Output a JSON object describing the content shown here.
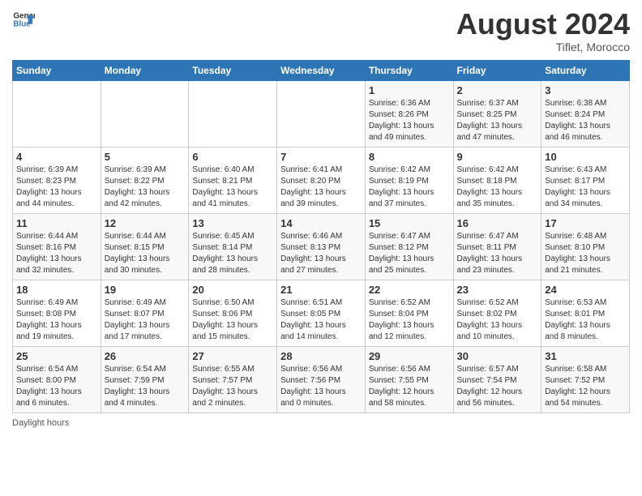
{
  "header": {
    "logo_general": "General",
    "logo_blue": "Blue",
    "month": "August 2024",
    "location": "Tiflet, Morocco"
  },
  "days_of_week": [
    "Sunday",
    "Monday",
    "Tuesday",
    "Wednesday",
    "Thursday",
    "Friday",
    "Saturday"
  ],
  "weeks": [
    [
      {
        "day": "",
        "info": ""
      },
      {
        "day": "",
        "info": ""
      },
      {
        "day": "",
        "info": ""
      },
      {
        "day": "",
        "info": ""
      },
      {
        "day": "1",
        "info": "Sunrise: 6:36 AM\nSunset: 8:26 PM\nDaylight: 13 hours and 49 minutes."
      },
      {
        "day": "2",
        "info": "Sunrise: 6:37 AM\nSunset: 8:25 PM\nDaylight: 13 hours and 47 minutes."
      },
      {
        "day": "3",
        "info": "Sunrise: 6:38 AM\nSunset: 8:24 PM\nDaylight: 13 hours and 46 minutes."
      }
    ],
    [
      {
        "day": "4",
        "info": "Sunrise: 6:39 AM\nSunset: 8:23 PM\nDaylight: 13 hours and 44 minutes."
      },
      {
        "day": "5",
        "info": "Sunrise: 6:39 AM\nSunset: 8:22 PM\nDaylight: 13 hours and 42 minutes."
      },
      {
        "day": "6",
        "info": "Sunrise: 6:40 AM\nSunset: 8:21 PM\nDaylight: 13 hours and 41 minutes."
      },
      {
        "day": "7",
        "info": "Sunrise: 6:41 AM\nSunset: 8:20 PM\nDaylight: 13 hours and 39 minutes."
      },
      {
        "day": "8",
        "info": "Sunrise: 6:42 AM\nSunset: 8:19 PM\nDaylight: 13 hours and 37 minutes."
      },
      {
        "day": "9",
        "info": "Sunrise: 6:42 AM\nSunset: 8:18 PM\nDaylight: 13 hours and 35 minutes."
      },
      {
        "day": "10",
        "info": "Sunrise: 6:43 AM\nSunset: 8:17 PM\nDaylight: 13 hours and 34 minutes."
      }
    ],
    [
      {
        "day": "11",
        "info": "Sunrise: 6:44 AM\nSunset: 8:16 PM\nDaylight: 13 hours and 32 minutes."
      },
      {
        "day": "12",
        "info": "Sunrise: 6:44 AM\nSunset: 8:15 PM\nDaylight: 13 hours and 30 minutes."
      },
      {
        "day": "13",
        "info": "Sunrise: 6:45 AM\nSunset: 8:14 PM\nDaylight: 13 hours and 28 minutes."
      },
      {
        "day": "14",
        "info": "Sunrise: 6:46 AM\nSunset: 8:13 PM\nDaylight: 13 hours and 27 minutes."
      },
      {
        "day": "15",
        "info": "Sunrise: 6:47 AM\nSunset: 8:12 PM\nDaylight: 13 hours and 25 minutes."
      },
      {
        "day": "16",
        "info": "Sunrise: 6:47 AM\nSunset: 8:11 PM\nDaylight: 13 hours and 23 minutes."
      },
      {
        "day": "17",
        "info": "Sunrise: 6:48 AM\nSunset: 8:10 PM\nDaylight: 13 hours and 21 minutes."
      }
    ],
    [
      {
        "day": "18",
        "info": "Sunrise: 6:49 AM\nSunset: 8:08 PM\nDaylight: 13 hours and 19 minutes."
      },
      {
        "day": "19",
        "info": "Sunrise: 6:49 AM\nSunset: 8:07 PM\nDaylight: 13 hours and 17 minutes."
      },
      {
        "day": "20",
        "info": "Sunrise: 6:50 AM\nSunset: 8:06 PM\nDaylight: 13 hours and 15 minutes."
      },
      {
        "day": "21",
        "info": "Sunrise: 6:51 AM\nSunset: 8:05 PM\nDaylight: 13 hours and 14 minutes."
      },
      {
        "day": "22",
        "info": "Sunrise: 6:52 AM\nSunset: 8:04 PM\nDaylight: 13 hours and 12 minutes."
      },
      {
        "day": "23",
        "info": "Sunrise: 6:52 AM\nSunset: 8:02 PM\nDaylight: 13 hours and 10 minutes."
      },
      {
        "day": "24",
        "info": "Sunrise: 6:53 AM\nSunset: 8:01 PM\nDaylight: 13 hours and 8 minutes."
      }
    ],
    [
      {
        "day": "25",
        "info": "Sunrise: 6:54 AM\nSunset: 8:00 PM\nDaylight: 13 hours and 6 minutes."
      },
      {
        "day": "26",
        "info": "Sunrise: 6:54 AM\nSunset: 7:59 PM\nDaylight: 13 hours and 4 minutes."
      },
      {
        "day": "27",
        "info": "Sunrise: 6:55 AM\nSunset: 7:57 PM\nDaylight: 13 hours and 2 minutes."
      },
      {
        "day": "28",
        "info": "Sunrise: 6:56 AM\nSunset: 7:56 PM\nDaylight: 13 hours and 0 minutes."
      },
      {
        "day": "29",
        "info": "Sunrise: 6:56 AM\nSunset: 7:55 PM\nDaylight: 12 hours and 58 minutes."
      },
      {
        "day": "30",
        "info": "Sunrise: 6:57 AM\nSunset: 7:54 PM\nDaylight: 12 hours and 56 minutes."
      },
      {
        "day": "31",
        "info": "Sunrise: 6:58 AM\nSunset: 7:52 PM\nDaylight: 12 hours and 54 minutes."
      }
    ]
  ],
  "footer": {
    "daylight_label": "Daylight hours"
  }
}
